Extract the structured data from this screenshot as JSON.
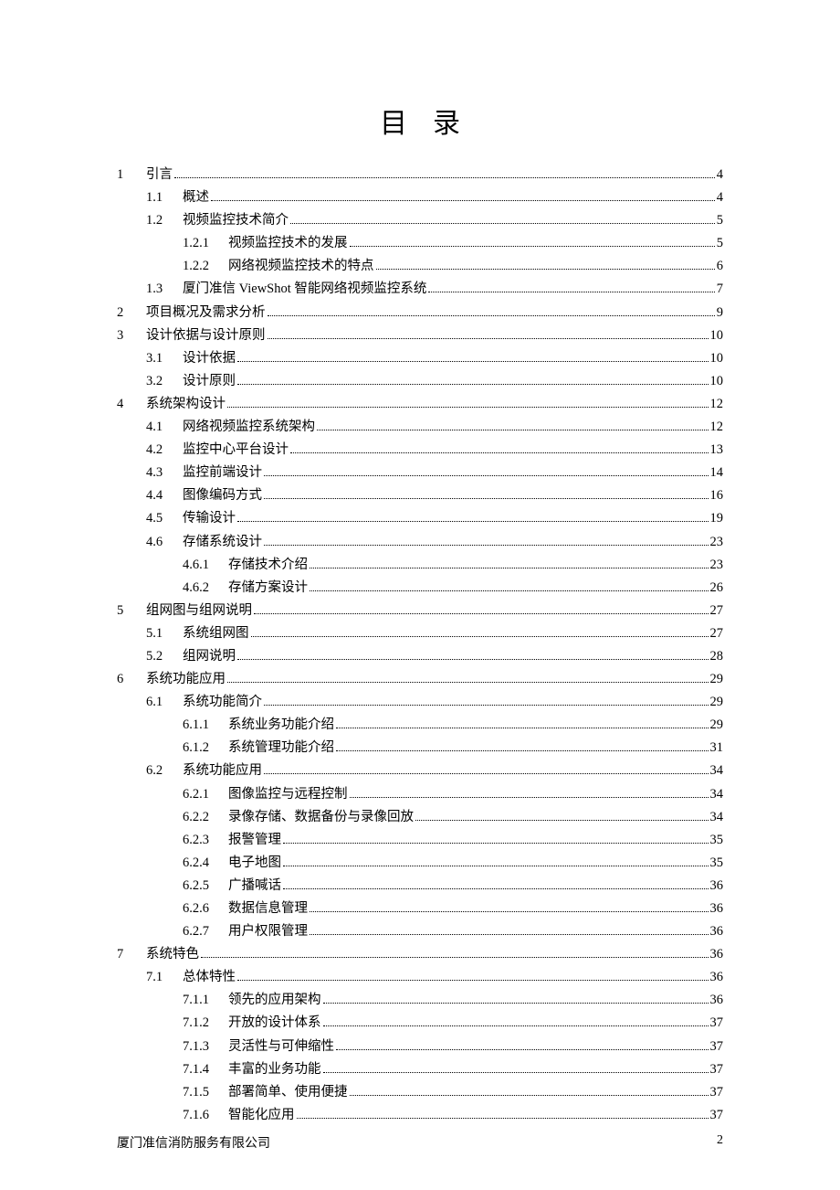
{
  "title": "目录",
  "footer": {
    "company": "厦门准信消防服务有限公司",
    "page": "2"
  },
  "entries": [
    {
      "level": 1,
      "num": "1",
      "label": "引言",
      "page": "4"
    },
    {
      "level": 2,
      "num": "1.1",
      "label": "概述",
      "page": "4"
    },
    {
      "level": 2,
      "num": "1.2",
      "label": "视频监控技术简介",
      "page": "5"
    },
    {
      "level": 3,
      "num": "1.2.1",
      "label": "视频监控技术的发展",
      "page": "5"
    },
    {
      "level": 3,
      "num": "1.2.2",
      "label": "网络视频监控技术的特点",
      "page": "6"
    },
    {
      "level": 2,
      "num": "1.3",
      "label": "厦门准信 ViewShot 智能网络视频监控系统",
      "page": "7"
    },
    {
      "level": 1,
      "num": "2",
      "label": "项目概况及需求分析",
      "page": "9"
    },
    {
      "level": 1,
      "num": "3",
      "label": "设计依据与设计原则",
      "page": "10"
    },
    {
      "level": 2,
      "num": "3.1",
      "label": "设计依据",
      "page": "10"
    },
    {
      "level": 2,
      "num": "3.2",
      "label": "设计原则",
      "page": "10"
    },
    {
      "level": 1,
      "num": "4",
      "label": "系统架构设计",
      "page": "12"
    },
    {
      "level": 2,
      "num": "4.1",
      "label": "网络视频监控系统架构",
      "page": "12"
    },
    {
      "level": 2,
      "num": "4.2",
      "label": "监控中心平台设计",
      "page": "13"
    },
    {
      "level": 2,
      "num": "4.3",
      "label": "监控前端设计",
      "page": "14"
    },
    {
      "level": 2,
      "num": "4.4",
      "label": "图像编码方式",
      "page": "16"
    },
    {
      "level": 2,
      "num": "4.5",
      "label": "传输设计",
      "page": "19"
    },
    {
      "level": 2,
      "num": "4.6",
      "label": "存储系统设计",
      "page": "23"
    },
    {
      "level": 3,
      "num": "4.6.1",
      "label": "存储技术介绍",
      "page": "23"
    },
    {
      "level": 3,
      "num": "4.6.2",
      "label": "存储方案设计",
      "page": "26"
    },
    {
      "level": 1,
      "num": "5",
      "label": "组网图与组网说明",
      "page": "27"
    },
    {
      "level": 2,
      "num": "5.1",
      "label": "系统组网图",
      "page": "27"
    },
    {
      "level": 2,
      "num": "5.2",
      "label": "组网说明",
      "page": "28"
    },
    {
      "level": 1,
      "num": "6",
      "label": "系统功能应用",
      "page": "29"
    },
    {
      "level": 2,
      "num": "6.1",
      "label": "系统功能简介",
      "page": "29"
    },
    {
      "level": 3,
      "num": "6.1.1",
      "label": "系统业务功能介绍",
      "page": "29"
    },
    {
      "level": 3,
      "num": "6.1.2",
      "label": "系统管理功能介绍",
      "page": "31"
    },
    {
      "level": 2,
      "num": "6.2",
      "label": "系统功能应用",
      "page": "34"
    },
    {
      "level": 3,
      "num": "6.2.1",
      "label": "图像监控与远程控制",
      "page": "34"
    },
    {
      "level": 3,
      "num": "6.2.2",
      "label": "录像存储、数据备份与录像回放",
      "page": "34"
    },
    {
      "level": 3,
      "num": "6.2.3",
      "label": "报警管理",
      "page": "35"
    },
    {
      "level": 3,
      "num": "6.2.4",
      "label": "电子地图",
      "page": "35"
    },
    {
      "level": 3,
      "num": "6.2.5",
      "label": "广播喊话",
      "page": "36"
    },
    {
      "level": 3,
      "num": "6.2.6",
      "label": "数据信息管理",
      "page": "36"
    },
    {
      "level": 3,
      "num": "6.2.7",
      "label": "用户权限管理",
      "page": "36"
    },
    {
      "level": 1,
      "num": "7",
      "label": "系统特色",
      "page": "36"
    },
    {
      "level": 2,
      "num": "7.1",
      "label": "总体特性",
      "page": "36"
    },
    {
      "level": 3,
      "num": "7.1.1",
      "label": "领先的应用架构",
      "page": "36"
    },
    {
      "level": 3,
      "num": "7.1.2",
      "label": "开放的设计体系",
      "page": "37"
    },
    {
      "level": 3,
      "num": "7.1.3",
      "label": "灵活性与可伸缩性",
      "page": "37"
    },
    {
      "level": 3,
      "num": "7.1.4",
      "label": "丰富的业务功能",
      "page": "37"
    },
    {
      "level": 3,
      "num": "7.1.5",
      "label": "部署简单、使用便捷",
      "page": "37"
    },
    {
      "level": 3,
      "num": "7.1.6",
      "label": "智能化应用",
      "page": "37"
    }
  ]
}
